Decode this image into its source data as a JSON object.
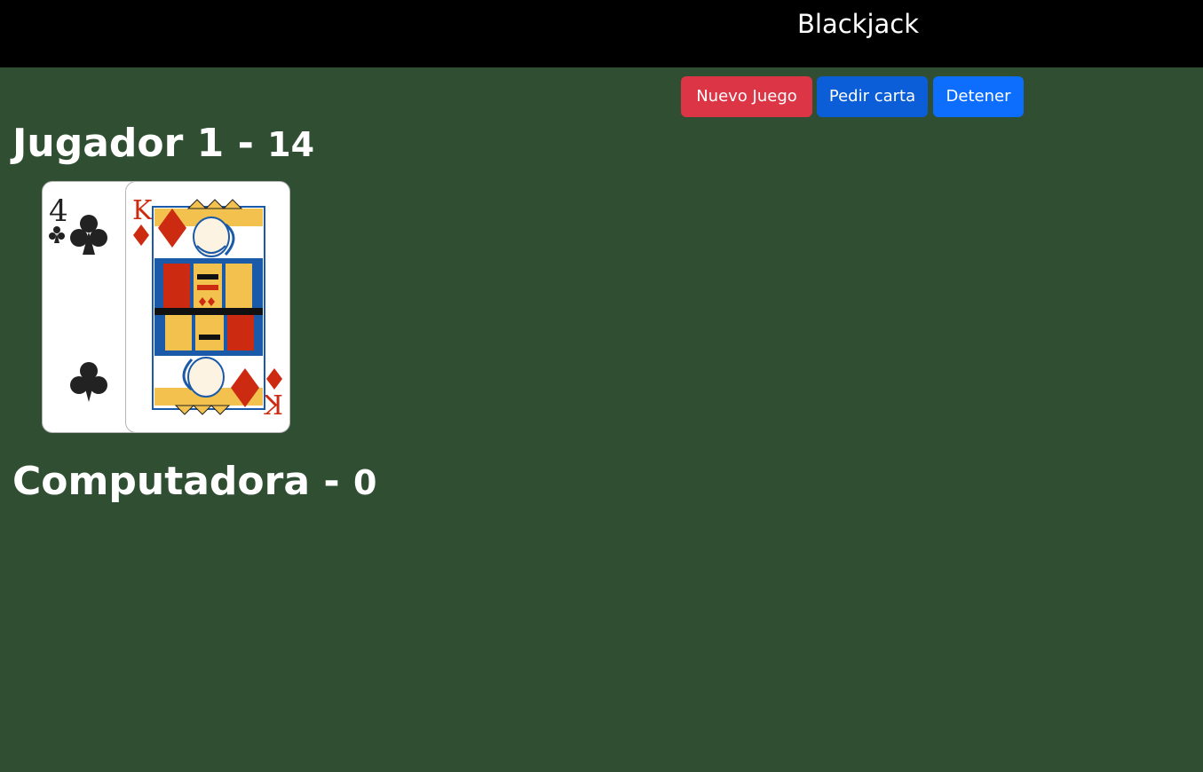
{
  "header": {
    "title": "Blackjack"
  },
  "controls": {
    "new_game": "Nuevo Juego",
    "ask_card": "Pedir carta",
    "stop": "Detener"
  },
  "player": {
    "name": "Jugador 1",
    "separator": " - ",
    "score": "14",
    "cards": [
      {
        "rank": "4",
        "suit": "clubs",
        "icon": "four-of-clubs-card"
      },
      {
        "rank": "K",
        "suit": "diamonds",
        "icon": "king-of-diamonds-card"
      }
    ]
  },
  "computer": {
    "name": "Computadora",
    "separator": " - ",
    "score": "0",
    "cards": []
  },
  "colors": {
    "table": "#304f32",
    "topbar": "#000000",
    "new_game": "#dc3545",
    "ask_card": "#0b5ed7",
    "stop": "#0d6efd"
  }
}
